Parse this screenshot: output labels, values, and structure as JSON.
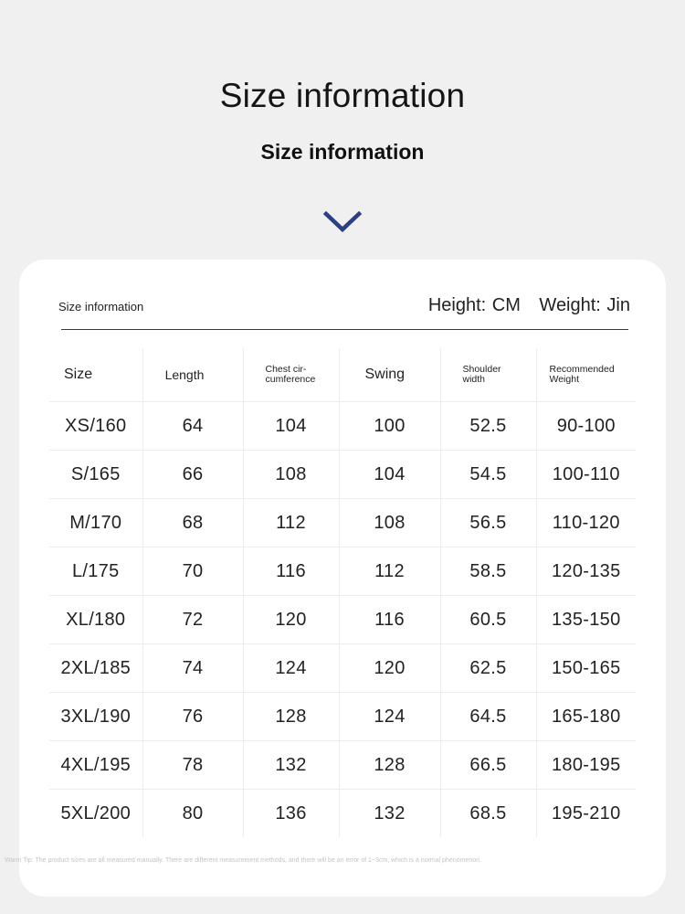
{
  "header": {
    "title": "Size information",
    "subtitle": "Size information",
    "chevron_icon": "chevron-down-icon",
    "chevron_color": "#2b3f82"
  },
  "card": {
    "label": "Size information",
    "height_unit": "Height: CM",
    "weight_unit": "Weight: Jin"
  },
  "table": {
    "headers": {
      "size": "Size",
      "length": "Length",
      "chest_line1": "Chest cir-",
      "chest_line2": "cumference",
      "swing": "Swing",
      "shoulder_line1": "Shoulder",
      "shoulder_line2": "width",
      "weight_line1": "Recommended",
      "weight_line2": "Weight"
    },
    "rows": [
      [
        "XS/160",
        "64",
        "104",
        "100",
        "52.5",
        "90-100"
      ],
      [
        "S/165",
        "66",
        "108",
        "104",
        "54.5",
        "100-110"
      ],
      [
        "M/170",
        "68",
        "112",
        "108",
        "56.5",
        "110-120"
      ],
      [
        "L/175",
        "70",
        "116",
        "112",
        "58.5",
        "120-135"
      ],
      [
        "XL/180",
        "72",
        "120",
        "116",
        "60.5",
        "135-150"
      ],
      [
        "2XL/185",
        "74",
        "124",
        "120",
        "62.5",
        "150-165"
      ],
      [
        "3XL/190",
        "76",
        "128",
        "124",
        "64.5",
        "165-180"
      ],
      [
        "4XL/195",
        "78",
        "132",
        "128",
        "66.5",
        "180-195"
      ],
      [
        "5XL/200",
        "80",
        "136",
        "132",
        "68.5",
        "195-210"
      ]
    ]
  },
  "footer": {
    "warm_tip": "Warm Tip: The product sizes are all measured manually. There are different measurement methods, and there will be an error of 1~3cm, which is a normal phenomenon."
  }
}
